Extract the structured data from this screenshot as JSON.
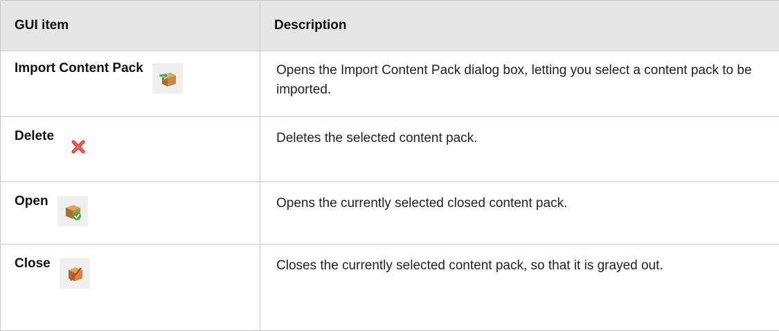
{
  "table": {
    "headers": {
      "item": "GUI item",
      "description": "Description"
    },
    "rows": [
      {
        "item": "Import Content Pack",
        "icon": "import-content-pack-icon",
        "description": "Opens the Import Content Pack dialog box, letting you select a content pack to be imported."
      },
      {
        "item": "Delete",
        "icon": "delete-icon",
        "description": "Deletes the selected content pack."
      },
      {
        "item": "Open",
        "icon": "open-content-pack-icon",
        "description": "Opens the currently selected closed content pack."
      },
      {
        "item": "Close",
        "icon": "close-content-pack-icon",
        "description": "Closes the currently selected content pack, so that it is grayed out."
      }
    ]
  },
  "colors": {
    "header_background": "#e6e6e6",
    "border": "#c8c8c8",
    "icon_background": "#efefef",
    "box_brown": "#b07a3a",
    "delete_red": "#e0332b",
    "check_green": "#4caf3a",
    "import_arrow_green": "#3faa5a"
  }
}
